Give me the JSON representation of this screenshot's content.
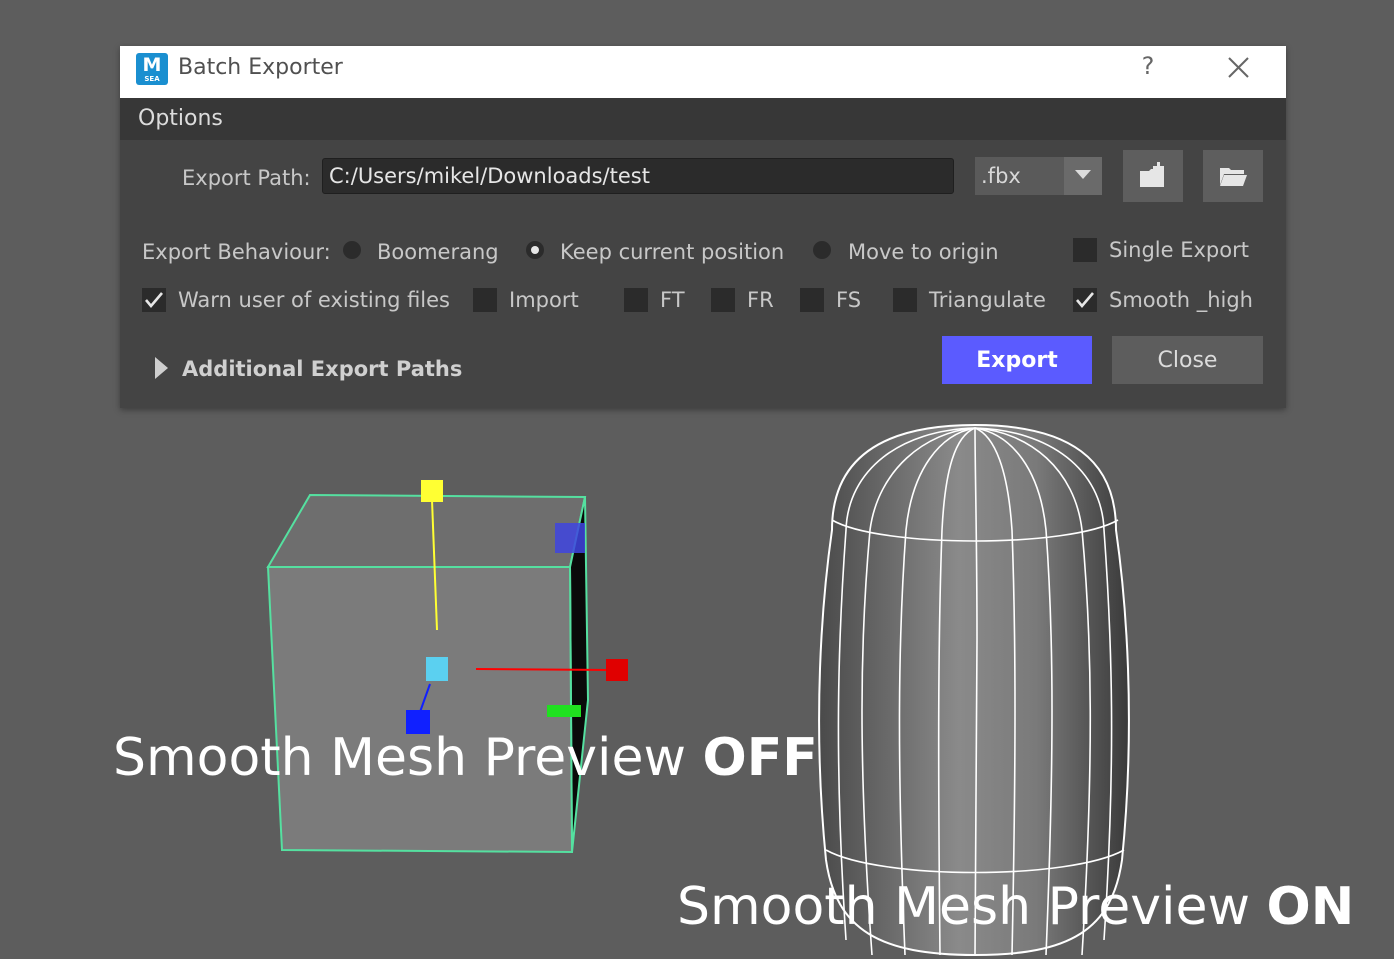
{
  "window": {
    "title": "Batch Exporter",
    "app_icon_letter": "M",
    "app_icon_subtext": "SEA",
    "help_label": "?"
  },
  "menu": {
    "options": "Options"
  },
  "export_path": {
    "label": "Export Path:",
    "value": "C:/Users/mikel/Downloads/test",
    "format": ".fbx"
  },
  "behaviour": {
    "label": "Export Behaviour:",
    "options": [
      {
        "label": "Boomerang",
        "selected": false
      },
      {
        "label": "Keep current position",
        "selected": true
      },
      {
        "label": "Move to origin",
        "selected": false
      }
    ]
  },
  "checkboxes": [
    {
      "label": "Single Export",
      "checked": false
    },
    {
      "label": "Warn user of existing files",
      "checked": true
    },
    {
      "label": "Import",
      "checked": false
    },
    {
      "label": "FT",
      "checked": false
    },
    {
      "label": "FR",
      "checked": false
    },
    {
      "label": "FS",
      "checked": false
    },
    {
      "label": "Triangulate",
      "checked": false
    },
    {
      "label": "Smooth _high",
      "checked": true
    }
  ],
  "additional": {
    "label": "Additional Export Paths"
  },
  "buttons": {
    "export": "Export",
    "close": "Close"
  },
  "colors": {
    "accent": "#5b5bff",
    "selection_wireframe": "#55e0a0",
    "manipulator_x": "#ff0000",
    "manipulator_y": "#ffff33",
    "manipulator_z": "#1020ff"
  },
  "captions": {
    "off_prefix": "Smooth Mesh Preview ",
    "off_state": "OFF",
    "on_prefix": "Smooth Mesh Preview ",
    "on_state": "ON"
  }
}
